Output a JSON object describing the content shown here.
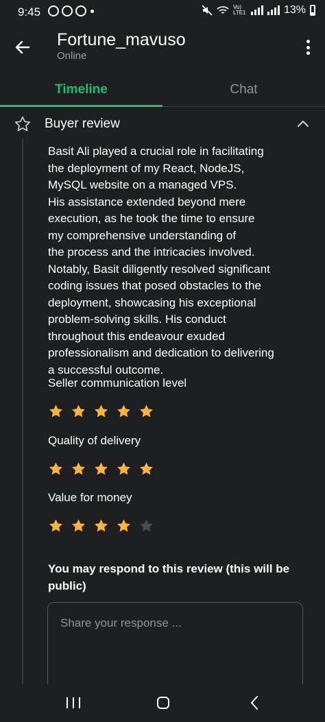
{
  "status_bar": {
    "time": "9:45",
    "network_label": "Vo) LTE1",
    "battery": "13%"
  },
  "header": {
    "title": "Fortune_mavuso",
    "subtitle": "Online"
  },
  "tabs": [
    {
      "label": "Timeline",
      "active": true
    },
    {
      "label": "Chat",
      "active": false
    }
  ],
  "review": {
    "title": "Buyer review",
    "text": "Basit Ali played a crucial role in facilitating\nthe deployment of my React, NodeJS,\nMySQL website on a managed VPS.\nHis assistance extended beyond mere\nexecution, as he took the time to ensure\nmy comprehensive understanding of\nthe process and the intricacies involved.\nNotably, Basit diligently resolved significant\ncoding issues that posed obstacles to the\ndeployment, showcasing his exceptional\nproblem-solving skills. His conduct\nthroughout this endeavour exuded\nprofessionalism and dedication to delivering\na successful outcome.",
    "ratings": [
      {
        "label": "Seller communication level",
        "stars": 5,
        "max": 5
      },
      {
        "label": "Quality of delivery",
        "stars": 5,
        "max": 5
      },
      {
        "label": "Value for money",
        "stars": 4,
        "max": 5
      }
    ],
    "respond_label": "You may respond to this review (this will be public)",
    "response_placeholder": "Share your response ..."
  },
  "colors": {
    "accent": "#1dbf73",
    "star_filled": "#ffb33e",
    "star_empty": "#4a4c4f",
    "background": "#1e1f21"
  },
  "icons": [
    "back-arrow-icon",
    "more-vert-icon",
    "star-outline-icon",
    "chevron-up-icon",
    "star-icon",
    "nav-recents-icon",
    "nav-home-icon",
    "nav-back-icon"
  ]
}
